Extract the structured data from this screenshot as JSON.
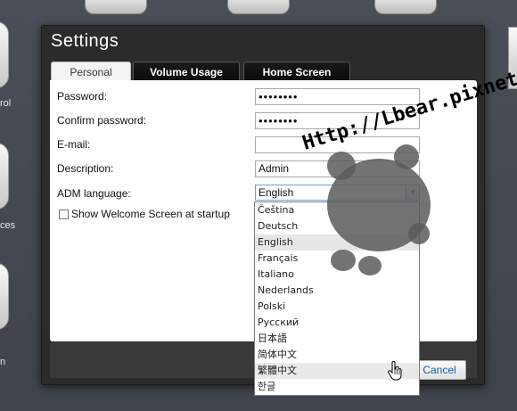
{
  "background": {
    "labels": [
      "rol",
      "ces",
      "n"
    ]
  },
  "dialog": {
    "title": "Settings",
    "tabs": [
      {
        "label": "Personal"
      },
      {
        "label": "Volume Usage"
      },
      {
        "label": "Home Screen"
      }
    ],
    "form": {
      "password_label": "Password:",
      "password_value": "••••••••",
      "confirm_label": "Confirm password:",
      "confirm_value": "••••••••",
      "email_label": "E-mail:",
      "email_value": "",
      "description_label": "Description:",
      "description_value": "Admin",
      "language_label": "ADM language:",
      "language_value": "English",
      "welcome_label": "Show Welcome Screen at startup"
    },
    "cancel_label": "Cancel"
  },
  "language_options": [
    "Čeština",
    "Deutsch",
    "English",
    "Français",
    "Italiano",
    "Nederlands",
    "Polski",
    "Русский",
    "日本語",
    "简体中文",
    "繁體中文",
    "한글"
  ],
  "selected_language": "English",
  "hover_language": "繁體中文",
  "watermark": {
    "text": "Http://Lbear.pixnet.net"
  },
  "colors": {
    "dialog_bg": "#2b2b2b",
    "tab_active": "#f4f4f4",
    "link_blue": "#1a5aa0"
  }
}
